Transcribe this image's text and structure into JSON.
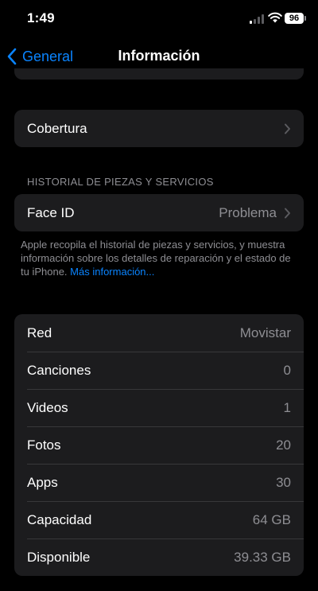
{
  "status_bar": {
    "time": "1:49",
    "battery": "96"
  },
  "nav": {
    "back_label": "General",
    "title": "Información"
  },
  "coverage": {
    "label": "Cobertura"
  },
  "parts_history": {
    "header": "HISTORIAL DE PIEZAS Y SERVICIOS",
    "face_id": {
      "label": "Face ID",
      "value": "Problema"
    },
    "footnote": "Apple recopila el historial de piezas y servicios, y muestra información sobre los detalles de reparación y el estado de tu iPhone.",
    "more_link": "Más información..."
  },
  "info_rows": [
    {
      "label": "Red",
      "value": "Movistar"
    },
    {
      "label": "Canciones",
      "value": "0"
    },
    {
      "label": "Videos",
      "value": "1"
    },
    {
      "label": "Fotos",
      "value": "20"
    },
    {
      "label": "Apps",
      "value": "30"
    },
    {
      "label": "Capacidad",
      "value": "64 GB"
    },
    {
      "label": "Disponible",
      "value": "39.33 GB"
    }
  ],
  "colors": {
    "accent": "#0a84ff",
    "card": "#1c1c1e",
    "secondary_text": "#8e8e93"
  }
}
